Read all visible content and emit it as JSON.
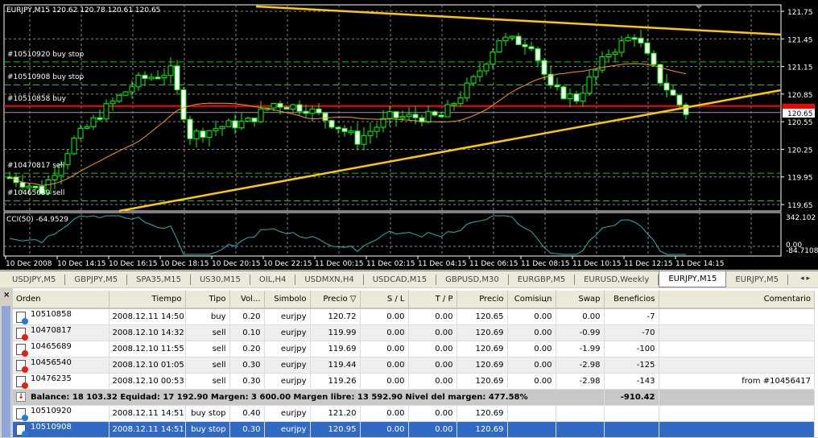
{
  "chart": {
    "title": "EURJPY,M15  120.62 120.78 120.61 120.65",
    "price_ticks": [
      "121.75",
      "121.45",
      "121.15",
      "120.85",
      "120.55",
      "120.25",
      "119.95",
      "119.65"
    ],
    "current_price": "120.65",
    "order_labels": [
      {
        "text": "#10510920 buy stop",
        "price": 121.2
      },
      {
        "text": "#10510908 buy stop",
        "price": 120.95
      },
      {
        "text": "#10510858 buy",
        "price": 120.72
      },
      {
        "text": "#10470817 sell",
        "price": 119.99
      },
      {
        "text": "#10465689 sell",
        "price": 119.69
      }
    ],
    "price_path": [
      [
        0,
        119.95
      ],
      [
        5,
        119.8
      ],
      [
        10,
        120.35
      ],
      [
        15,
        120.7
      ],
      [
        20,
        121.0
      ],
      [
        25,
        121.1
      ],
      [
        28,
        120.4
      ],
      [
        33,
        120.5
      ],
      [
        37,
        120.55
      ],
      [
        41,
        120.75
      ],
      [
        46,
        120.7
      ],
      [
        51,
        120.5
      ],
      [
        54,
        120.35
      ],
      [
        59,
        120.6
      ],
      [
        67,
        120.6
      ],
      [
        72,
        121.0
      ],
      [
        76,
        121.45
      ],
      [
        81,
        121.4
      ],
      [
        84,
        120.9
      ],
      [
        88,
        120.8
      ],
      [
        93,
        121.3
      ],
      [
        97,
        121.5
      ],
      [
        101,
        121.0
      ],
      [
        105,
        120.65
      ]
    ],
    "indicator": {
      "label": "CCI(50) -64.9529",
      "max": "342.102",
      "zero": "0.00",
      "min": "-84.7108"
    },
    "time_labels": [
      "10 Dec 2008",
      "10 Dec 14:15",
      "10 Dec 16:15",
      "10 Dec 18:15",
      "10 Dec 20:15",
      "10 Dec 22:15",
      "11 Dec 00:15",
      "11 Dec 02:15",
      "11 Dec 04:15",
      "11 Dec 06:15",
      "11 Dec 08:15",
      "11 Dec 10:15",
      "11 Dec 12:15",
      "11 Dec 14:15"
    ],
    "colors": {
      "bull": "#00ff00",
      "trend": "#ffc800",
      "order": "#ff0000",
      "ma": "#ff9900",
      "cci": "#20b2aa",
      "grid": "#7f8a99"
    }
  },
  "tabs": [
    "USDJPY,M5",
    "GBPJPY,M5",
    "SPA35,M15",
    "US30,M15",
    "OIL,H4",
    "USDMXN,H4",
    "USDCAD,M15",
    "GBPUSD,M30",
    "EURGBP,M5",
    "EURUSD,Weekly",
    "EURJPY,M15",
    "EURJPY,M5"
  ],
  "active_tab": 10,
  "terminal": {
    "close": "×",
    "columns": [
      "Orden",
      "Tiempo",
      "Tipo",
      "Vol...",
      "Simbolo",
      "Precio ▽",
      "S / L",
      "T / P",
      "Precio",
      "Comisiцn",
      "Swap",
      "Beneficios",
      "Comentario"
    ],
    "rows": [
      [
        "10510858",
        "2008.12.11 14:50",
        "buy",
        "0.20",
        "eurjpy",
        "120.72",
        "0.00",
        "0.00",
        "120.65",
        "0.00",
        "0.00",
        "-7",
        ""
      ],
      [
        "10470817",
        "2008.12.10 14:32",
        "sell",
        "0.10",
        "eurjpy",
        "119.99",
        "0.00",
        "0.00",
        "120.69",
        "0.00",
        "-0.99",
        "-70",
        ""
      ],
      [
        "10465689",
        "2008.12.10 11:55",
        "sell",
        "0.20",
        "eurjpy",
        "119.69",
        "0.00",
        "0.00",
        "120.69",
        "0.00",
        "-1.99",
        "-100",
        ""
      ],
      [
        "10456540",
        "2008.12.10 01:05",
        "sell",
        "0.30",
        "eurjpy",
        "119.44",
        "0.00",
        "0.00",
        "120.69",
        "0.00",
        "-2.98",
        "-125",
        ""
      ],
      [
        "10476235",
        "2008.12.10 00:53",
        "sell",
        "0.30",
        "eurjpy",
        "119.26",
        "0.00",
        "0.00",
        "120.69",
        "0.00",
        "-2.98",
        "-143",
        "from #10456417"
      ]
    ],
    "balance": "Balance: 18 103.32  Equidad: 17 192.90  Margen: 3 600.00  Margen libre: 13 592.90  Nivel del margen: 477.58%",
    "balance_profit": "-910.42",
    "pending": [
      [
        "10510920",
        "2008.12.11 14:51",
        "buy stop",
        "0.40",
        "eurjpy",
        "121.20",
        "0.00",
        "0.00",
        "120.69",
        "",
        "",
        "",
        ""
      ],
      [
        "10510908",
        "2008.12.11 14:51",
        "buy stop",
        "0.30",
        "eurjpy",
        "120.95",
        "0.00",
        "0.00",
        "120.69",
        "",
        "",
        "",
        ""
      ]
    ]
  }
}
